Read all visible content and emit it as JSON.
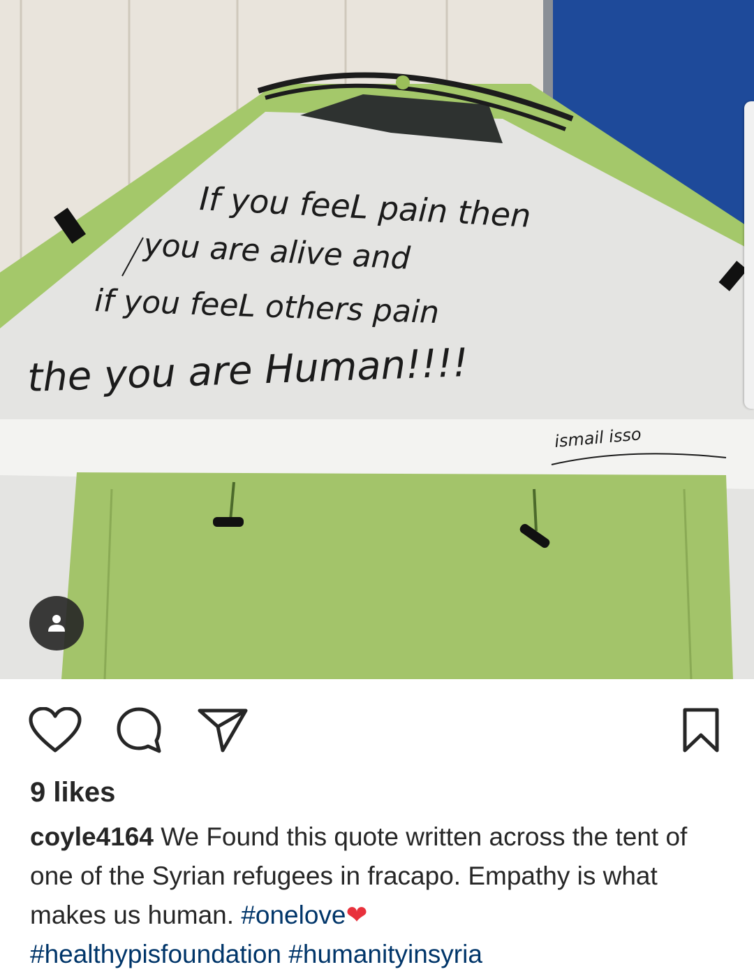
{
  "photo": {
    "description_icon": "tent-photo",
    "signature": "ismail isso",
    "handwritten_lines": [
      "If you feeL pain then",
      "you are alive and",
      "if you feeL others pain",
      "the you are Human!!!!"
    ]
  },
  "tag_button": {
    "icon": "user-tag-icon"
  },
  "actions": {
    "like_icon": "heart-icon",
    "comment_icon": "comment-icon",
    "share_icon": "paper-plane-icon",
    "save_icon": "bookmark-icon"
  },
  "likes": "9 likes",
  "caption": {
    "username": "coyle4164",
    "text": " We Found this quote written across the tent of one of the Syrian refugees in fracapo. Empathy is what makes us human. ",
    "hashtag": "#onelove",
    "emoji": "❤",
    "cut_off_line": "#healthypisfoundation #humanityinsyria"
  },
  "colors": {
    "tent_green": "#a4c86a",
    "tent_silver": "#e6e6e6",
    "door_blue": "#1e4a9a",
    "hashtag": "#003569",
    "text": "#262626"
  }
}
